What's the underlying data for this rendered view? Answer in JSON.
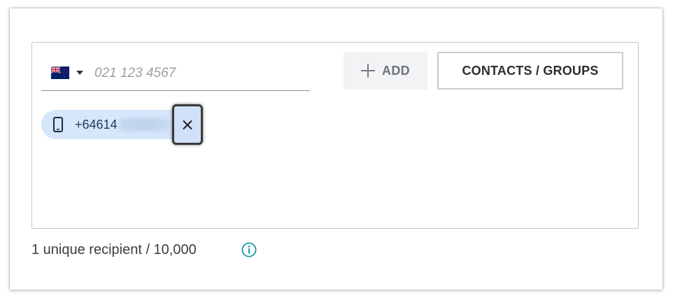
{
  "recipient_input": {
    "country_flag": "new-zealand-flag-icon",
    "placeholder": "021 123 4567",
    "value": ""
  },
  "actions": {
    "add_label": "ADD",
    "contacts_label": "CONTACTS / GROUPS"
  },
  "recipients": [
    {
      "type": "mobile",
      "number_visible": "+64614",
      "number_obscured": true
    }
  ],
  "summary": {
    "text": "1 unique recipient / 10,000"
  },
  "colors": {
    "chip_background": "#d6e6fb",
    "info_accent": "#1a9aa8",
    "add_button_bg": "#f2f3f4"
  }
}
